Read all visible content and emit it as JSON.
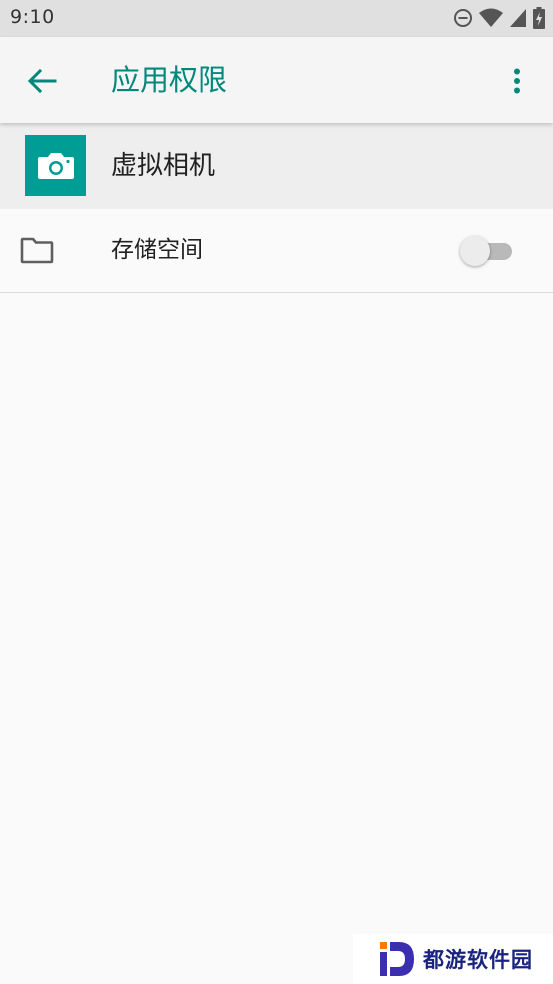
{
  "status_bar": {
    "time": "9:10",
    "icons": [
      "dnd-icon",
      "wifi-icon",
      "signal-icon",
      "battery-charging-icon"
    ]
  },
  "app_bar": {
    "title": "应用权限",
    "back_icon": "arrow-left-icon",
    "menu_icon": "more-vert-icon",
    "accent_color": "#00897b"
  },
  "app_header": {
    "name": "虚拟相机",
    "icon": "camera-icon",
    "icon_bg_color": "#009d94"
  },
  "permissions": [
    {
      "label": "存储空间",
      "icon": "folder-icon",
      "enabled": false
    }
  ],
  "watermark": {
    "text": "都游软件园"
  }
}
